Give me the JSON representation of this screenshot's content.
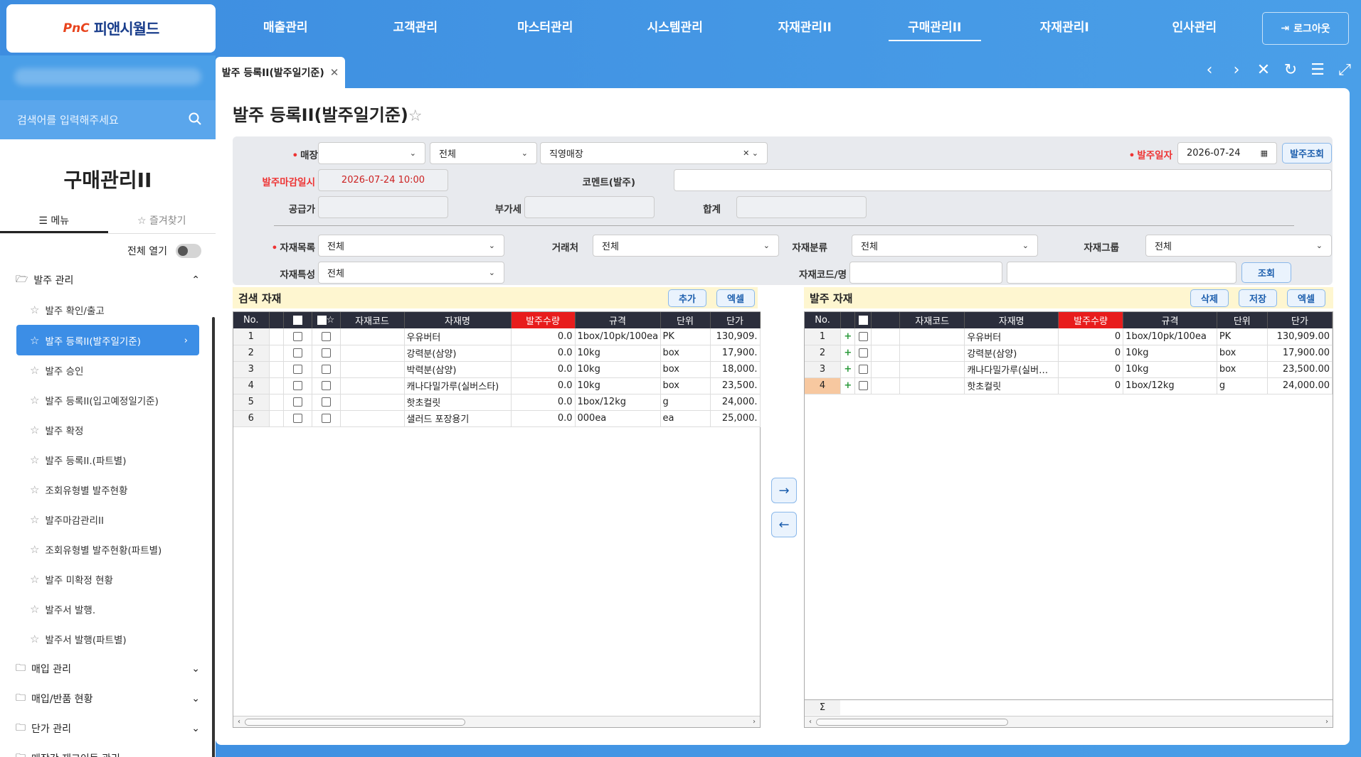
{
  "brand": {
    "logo_mark": "PnC",
    "logo_text": "피앤시월드"
  },
  "nav": [
    "매출관리",
    "고객관리",
    "마스터관리",
    "시스템관리",
    "자재관리II",
    "구매관리II",
    "자재관리I",
    "인사관리"
  ],
  "nav_active_index": 5,
  "logout_label": "로그아웃",
  "sidebar": {
    "search_placeholder": "검색어를 입력해주세요",
    "title": "구매관리II",
    "tab_menu": "메뉴",
    "tab_fav": "즐겨찾기",
    "expand_all": "전체 열기",
    "group_open": "발주 관리",
    "items": [
      "발주 확인/출고",
      "발주 등록II(발주일기준)",
      "발주 승인",
      "발주 등록II(입고예정일기준)",
      "발주 확정",
      "발주 등록II.(파트별)",
      "조회유형별 발주현황",
      "발주마감관리II",
      "조회유형별 발주현황(파트별)",
      "발주 미확정 현황",
      "발주서 발행.",
      "발주서 발행(파트별)"
    ],
    "active_index": 1,
    "groups_closed": [
      "매입 관리",
      "매입/반품 현황",
      "단가 관리",
      "매장간 재고이동 관리"
    ]
  },
  "tab": {
    "label": "발주 등록II(발주일기준)"
  },
  "page": {
    "title": "발주 등록II(발주일기준)"
  },
  "form": {
    "store_label": "매장",
    "store_value": "",
    "store_type": "전체",
    "store_sub": "직영매장",
    "order_date_label": "발주일자",
    "order_date": "2026-07-24",
    "order_search_btn": "발주조회",
    "deadline_label": "발주마감일시",
    "deadline": "2026-07-24 10:00",
    "comment_label": "코멘트(발주)",
    "comment": "",
    "supply_label": "공급가",
    "supply": "",
    "vat_label": "부가세",
    "vat": "",
    "total_label": "합계",
    "total": "",
    "mat_list_label": "자재목록",
    "mat_list": "전체",
    "vendor_label": "거래처",
    "vendor": "전체",
    "mat_class_label": "자재분류",
    "mat_class": "전체",
    "mat_group_label": "자재그룹",
    "mat_group": "전체",
    "mat_prop_label": "자재특성",
    "mat_prop": "전체",
    "mat_code_label": "자재코드/명",
    "mat_code": "",
    "mat_name": "",
    "search_btn": "조회"
  },
  "left_grid": {
    "title": "검색 자재",
    "add_btn": "추가",
    "excel_btn": "엑셀",
    "columns": [
      "No.",
      "",
      "",
      "자재코드",
      "자재명",
      "발주수량",
      "규격",
      "단위",
      "단가"
    ],
    "rows": [
      [
        "1",
        "",
        "우유버터",
        "0.0",
        "1box/10pk/100ea",
        "PK",
        "130,909."
      ],
      [
        "2",
        "",
        "강력분(삼양)",
        "0.0",
        "10kg",
        "box",
        "17,900."
      ],
      [
        "3",
        "",
        "박력분(삼양)",
        "0.0",
        "10kg",
        "box",
        "18,000."
      ],
      [
        "4",
        "",
        "캐나다밀가루(실버스타)",
        "0.0",
        "10kg",
        "box",
        "23,500."
      ],
      [
        "5",
        "",
        "핫초컬릿",
        "0.0",
        "1box/12kg",
        "g",
        "24,000."
      ],
      [
        "6",
        "",
        "샐러드 포장용기",
        "0.0",
        "000ea",
        "ea",
        "25,000."
      ]
    ]
  },
  "right_grid": {
    "title": "발주 자재",
    "delete_btn": "삭제",
    "save_btn": "저장",
    "excel_btn": "엑셀",
    "columns": [
      "No.",
      "",
      "",
      "자재코드",
      "자재명",
      "발주수량",
      "규격",
      "단위",
      "단가"
    ],
    "rows": [
      [
        "1",
        "",
        "우유버터",
        "0",
        "1box/10pk/100ea",
        "PK",
        "130,909.00"
      ],
      [
        "2",
        "",
        "강력분(삼양)",
        "0",
        "10kg",
        "box",
        "17,900.00"
      ],
      [
        "3",
        "",
        "캐나다밀가루(실버…",
        "0",
        "10kg",
        "box",
        "23,500.00"
      ],
      [
        "4",
        "",
        "핫초컬릿",
        "0",
        "1box/12kg",
        "g",
        "24,000.00"
      ]
    ],
    "sum_symbol": "Σ"
  },
  "colors": {
    "accent": "#3c8ee6",
    "header_dark": "#2b2e3c",
    "hot": "#e81c1c",
    "required": "#e33333"
  }
}
